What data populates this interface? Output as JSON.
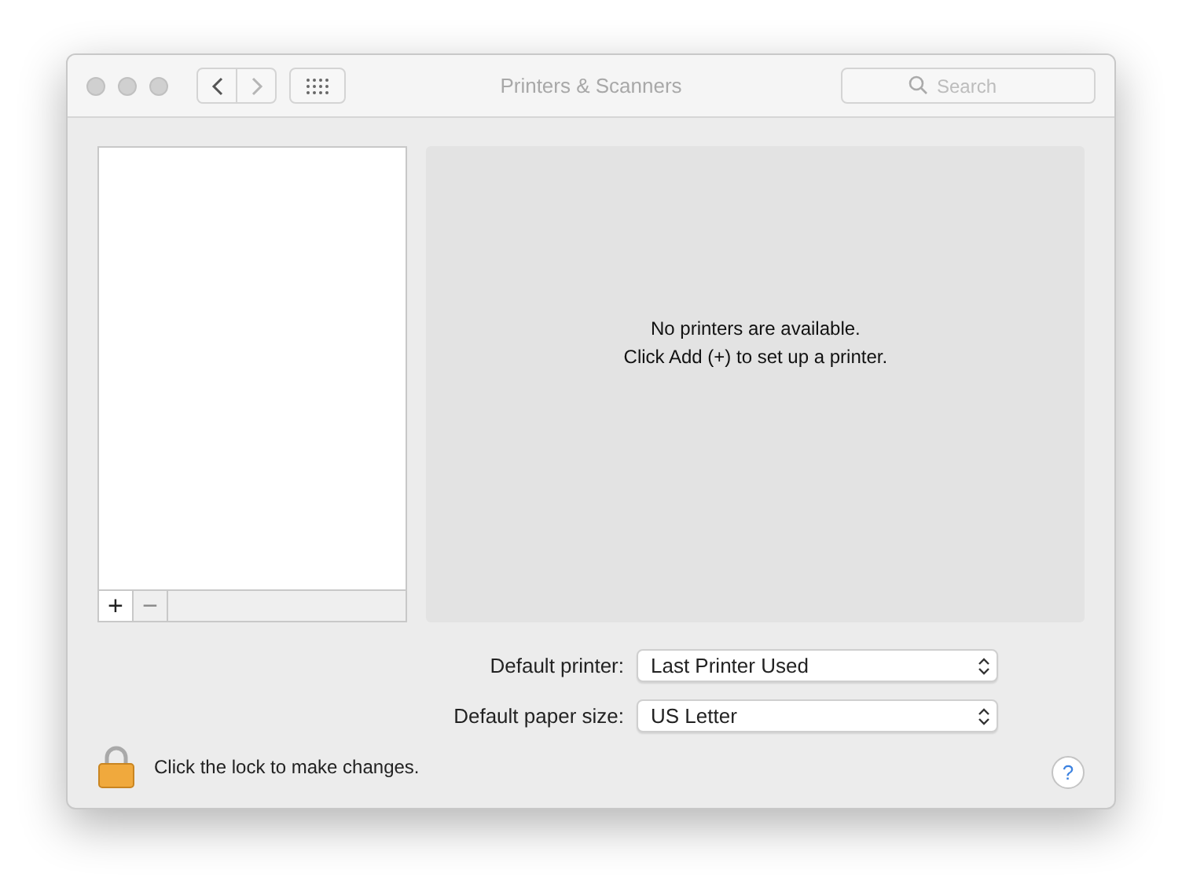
{
  "window": {
    "title": "Printers & Scanners"
  },
  "toolbar": {
    "nav": [
      {
        "kind": "back",
        "disabled": false
      },
      {
        "kind": "forward",
        "disabled": true
      }
    ],
    "search": {
      "placeholder": "Search"
    }
  },
  "printer_list": {
    "buttons": [
      {
        "label": "+",
        "disabled": false
      },
      {
        "label": "−",
        "disabled": true
      }
    ]
  },
  "message": [
    "No printers are available.",
    "Click Add (+) to set up a printer."
  ],
  "settings": [
    {
      "label": "Default printer:",
      "value": "Last Printer Used"
    },
    {
      "label": "Default paper size:",
      "value": "US Letter"
    }
  ],
  "lock": {
    "text": "Click the lock to make changes."
  },
  "help": {
    "label": "?"
  }
}
